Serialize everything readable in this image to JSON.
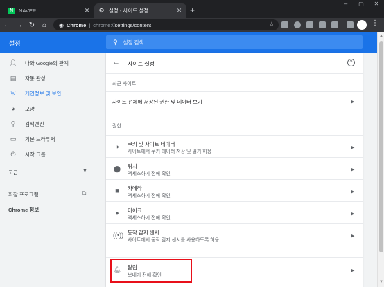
{
  "browser": {
    "tabs": [
      {
        "title": "NAVER",
        "favicon": "naver-logo",
        "active": false
      },
      {
        "title": "설정 - 사이트 설정",
        "favicon": "gear-icon",
        "active": true
      }
    ],
    "new_tab_label": "+",
    "omnibox": {
      "chip": "Chrome",
      "separator": "|",
      "url_host": "chrome://",
      "url_path": "settings/content"
    }
  },
  "settings": {
    "app_title": "설정",
    "search_placeholder": "설정 검색",
    "header_color": "#1a73e8",
    "sidebar": {
      "items": [
        {
          "label": "나와 Google의 관계",
          "icon": "person-icon",
          "active": false
        },
        {
          "label": "자동 완성",
          "icon": "clipboard-icon",
          "active": false
        },
        {
          "label": "개인정보 및 보안",
          "icon": "shield-icon",
          "active": true
        },
        {
          "label": "모양",
          "icon": "palette-icon",
          "active": false
        },
        {
          "label": "검색엔진",
          "icon": "search-icon",
          "active": false
        },
        {
          "label": "기본 브라우저",
          "icon": "browser-icon",
          "active": false
        },
        {
          "label": "시작 그룹",
          "icon": "power-icon",
          "active": false
        }
      ],
      "advanced": "고급",
      "extensions": "확장 프로그램",
      "about": "Chrome 정보"
    },
    "page": {
      "title": "사이트 설정",
      "recent_label": "최근 사이트",
      "all_sites_row": "사이트 전체에 저장된 권한 및 데이터 보기",
      "permissions_label": "권한",
      "permissions": [
        {
          "title": "쿠키 및 사이트 데이터",
          "subtitle": "사이트에서 쿠키 데이터 저장 및 읽기 허용",
          "icon": "cookie-icon"
        },
        {
          "title": "위치",
          "subtitle": "액세스하기 전에 확인",
          "icon": "location-pin-icon"
        },
        {
          "title": "카메라",
          "subtitle": "액세스하기 전에 확인",
          "icon": "camera-icon"
        },
        {
          "title": "마이크",
          "subtitle": "액세스하기 전에 확인",
          "icon": "microphone-icon"
        },
        {
          "title": "동작 감지 센서",
          "subtitle": "사이트에서 동작 감지 센서를 사용하도록 허용",
          "icon": "sensor-icon"
        },
        {
          "title": "알림",
          "subtitle": "보내기 전에 확인",
          "icon": "bell-icon"
        }
      ]
    }
  }
}
